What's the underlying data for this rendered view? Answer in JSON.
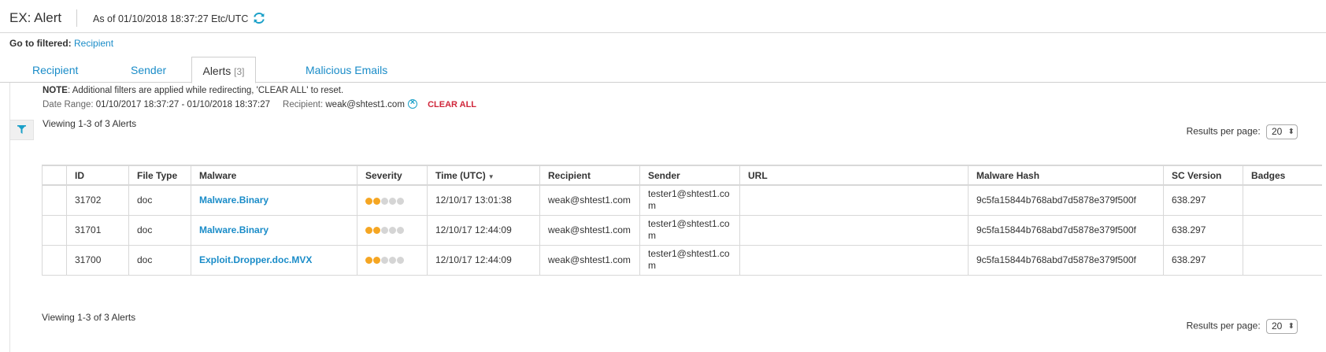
{
  "header": {
    "title": "EX: Alert",
    "as_of": "As of 01/10/2018 18:37:27 Etc/UTC"
  },
  "goto": {
    "label": "Go to filtered:",
    "link": "Recipient"
  },
  "tabs": [
    {
      "label": "Recipient",
      "count": ""
    },
    {
      "label": "Sender",
      "count": ""
    },
    {
      "label": "Alerts",
      "count": "[3]"
    },
    {
      "label": "Malicious Emails",
      "count": ""
    }
  ],
  "note": {
    "bold": "NOTE",
    "text": ": Additional filters are applied while redirecting, 'CLEAR ALL' to reset."
  },
  "criteria": {
    "date_label": "Date Range:",
    "date_value": "01/10/2017 18:37:27 - 01/10/2018 18:37:27",
    "recipient_label": "Recipient:",
    "recipient_value": "weak@shtest1.com",
    "clear_all": "CLEAR ALL"
  },
  "viewing": "Viewing 1-3 of 3 Alerts",
  "results_per_page": {
    "label": "Results per page:",
    "value": "20"
  },
  "table": {
    "headers": [
      "ID",
      "File Type",
      "Malware",
      "Severity",
      "Time (UTC)",
      "Recipient",
      "Sender",
      "URL",
      "Malware Hash",
      "SC Version",
      "Badges"
    ],
    "rows": [
      {
        "id": "31702",
        "file_type": "doc",
        "malware": "Malware.Binary",
        "severity": 2,
        "time": "12/10/17 13:01:38",
        "recipient": "weak@shtest1.com",
        "sender": "tester1@shtest1.com",
        "url": "",
        "hash": "9c5fa15844b768abd7d5878e379f500f",
        "sc_version": "638.297",
        "badges": ""
      },
      {
        "id": "31701",
        "file_type": "doc",
        "malware": "Malware.Binary",
        "severity": 2,
        "time": "12/10/17 12:44:09",
        "recipient": "weak@shtest1.com",
        "sender": "tester1@shtest1.com",
        "url": "",
        "hash": "9c5fa15844b768abd7d5878e379f500f",
        "sc_version": "638.297",
        "badges": ""
      },
      {
        "id": "31700",
        "file_type": "doc",
        "malware": "Exploit.Dropper.doc.MVX",
        "severity": 2,
        "time": "12/10/17 12:44:09",
        "recipient": "weak@shtest1.com",
        "sender": "tester1@shtest1.com",
        "url": "",
        "hash": "9c5fa15844b768abd7d5878e379f500f",
        "sc_version": "638.297",
        "badges": ""
      }
    ]
  },
  "colors": {
    "link": "#1a8cc8",
    "severity_on": "#f5a623",
    "severity_off": "#d5d5d5",
    "clear_all": "#d0263a"
  },
  "icons": [
    "refresh-icon",
    "clear-filter-icon",
    "filter-icon",
    "sort-desc-icon"
  ]
}
